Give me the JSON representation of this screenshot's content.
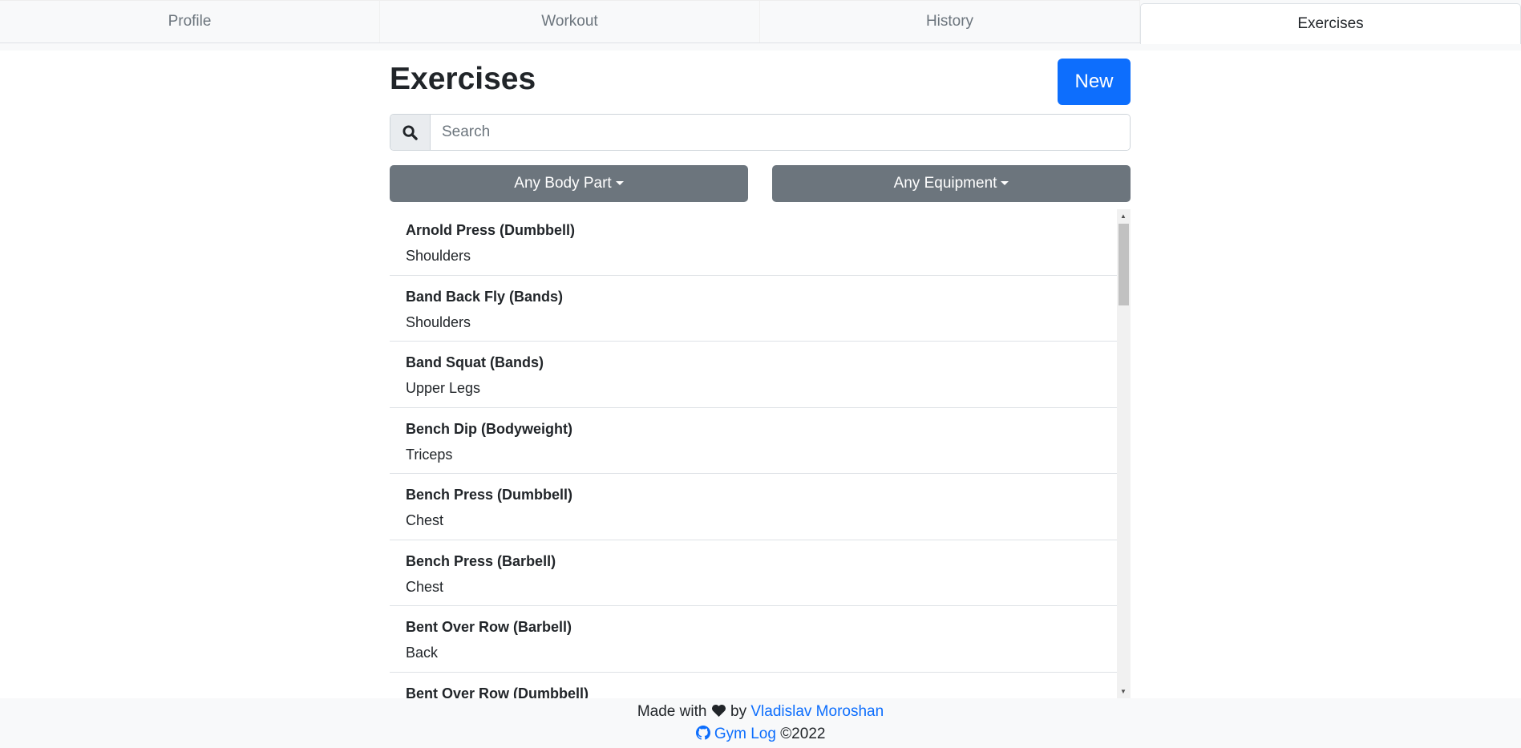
{
  "tabs": [
    {
      "label": "Profile"
    },
    {
      "label": "Workout"
    },
    {
      "label": "History"
    },
    {
      "label": "Exercises",
      "active": true
    }
  ],
  "page": {
    "title": "Exercises",
    "new_label": "New"
  },
  "search": {
    "placeholder": "Search",
    "value": ""
  },
  "filters": {
    "body_part": "Any Body Part",
    "equipment": "Any Equipment"
  },
  "exercises": [
    {
      "name": "Arnold Press (Dumbbell)",
      "part": "Shoulders"
    },
    {
      "name": "Band Back Fly (Bands)",
      "part": "Shoulders"
    },
    {
      "name": "Band Squat (Bands)",
      "part": "Upper Legs"
    },
    {
      "name": "Bench Dip (Bodyweight)",
      "part": "Triceps"
    },
    {
      "name": "Bench Press (Dumbbell)",
      "part": "Chest"
    },
    {
      "name": "Bench Press (Barbell)",
      "part": "Chest"
    },
    {
      "name": "Bent Over Row (Barbell)",
      "part": "Back"
    },
    {
      "name": "Bent Over Row (Dumbbell)",
      "part": ""
    }
  ],
  "footer": {
    "made_with": "Made with",
    "by": "by",
    "author": "Vladislav Moroshan",
    "repo": "Gym Log",
    "copyright": "©2022"
  },
  "colors": {
    "primary": "#0d6efd",
    "secondary": "#6c757d"
  }
}
